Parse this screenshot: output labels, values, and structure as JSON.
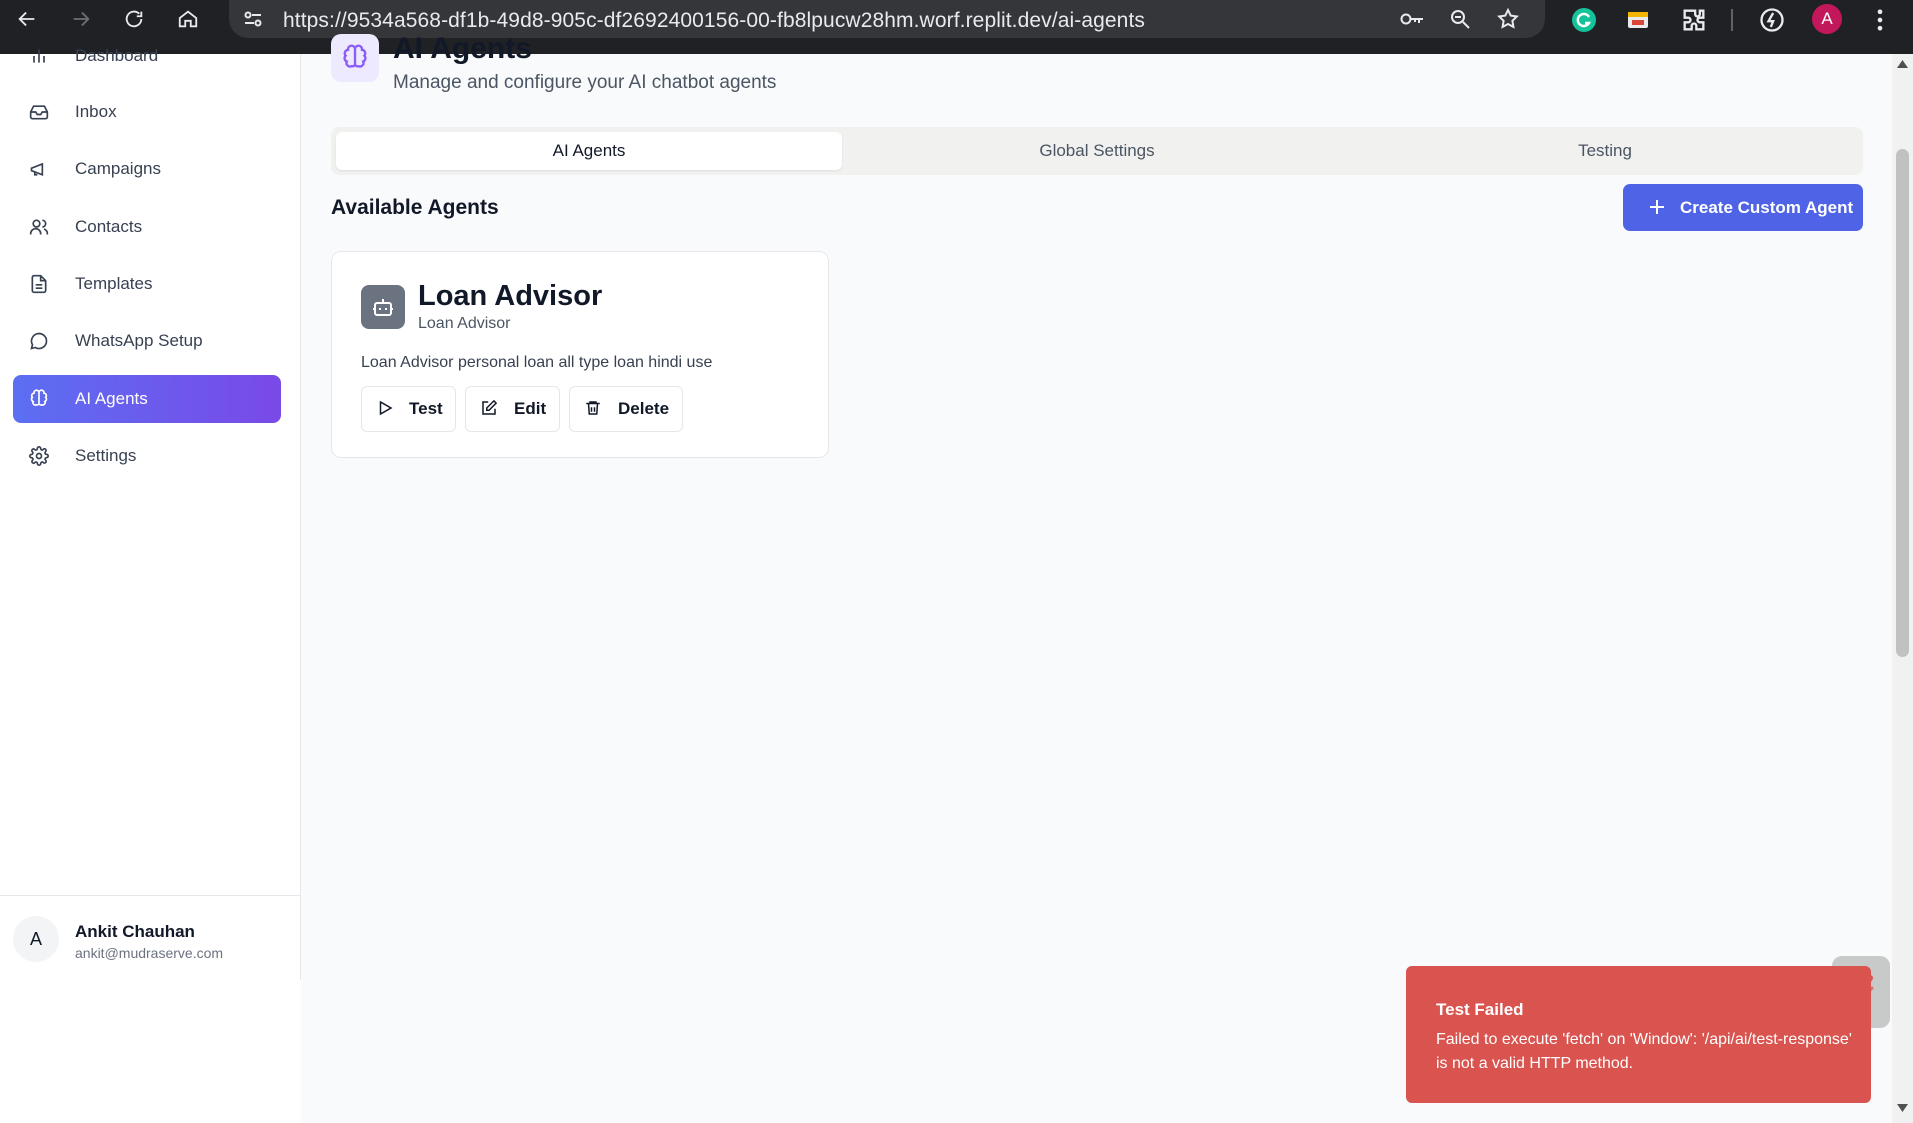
{
  "browser": {
    "url": "https://9534a568-df1b-49d8-905c-df2692400156-00-fb8lpucw28hm.worf.replit.dev/ai-agents",
    "profile_initial": "A",
    "icons": [
      "back-icon",
      "forward-icon",
      "reload-icon",
      "home-icon",
      "site-settings-icon",
      "password-key-icon",
      "zoom-icon",
      "bookmark-star-icon",
      "grammarly-icon",
      "extension-icon",
      "puzzle-extensions-icon",
      "speed-icon",
      "menu-kebab-icon"
    ]
  },
  "sidebar": {
    "items": [
      {
        "label": "Dashboard",
        "icon": "bar-chart-icon"
      },
      {
        "label": "Inbox",
        "icon": "inbox-icon"
      },
      {
        "label": "Campaigns",
        "icon": "megaphone-icon"
      },
      {
        "label": "Contacts",
        "icon": "users-icon"
      },
      {
        "label": "Templates",
        "icon": "file-text-icon"
      },
      {
        "label": "WhatsApp Setup",
        "icon": "message-circle-icon"
      },
      {
        "label": "AI Agents",
        "icon": "brain-icon",
        "active": true
      },
      {
        "label": "Settings",
        "icon": "gear-icon"
      }
    ],
    "user": {
      "initial": "A",
      "name": "Ankit Chauhan",
      "email": "ankit@mudraserve.com"
    }
  },
  "header": {
    "title": "AI Agents",
    "subtitle": "Manage and configure your AI chatbot agents"
  },
  "tabs": [
    {
      "label": "AI Agents",
      "active": true
    },
    {
      "label": "Global Settings"
    },
    {
      "label": "Testing"
    }
  ],
  "section": {
    "title": "Available Agents",
    "create_label": "Create Custom Agent"
  },
  "agents": [
    {
      "name": "Loan Advisor",
      "role": "Loan Advisor",
      "description": "Loan Advisor personal loan all type loan hindi use",
      "actions": {
        "test": "Test",
        "edit": "Edit",
        "delete": "Delete"
      }
    }
  ],
  "toast": {
    "title": "Test Failed",
    "message": "Failed to execute 'fetch' on 'Window': '/api/ai/test-response' is not a valid HTTP method."
  },
  "colors": {
    "accent_start": "#5b6ff2",
    "accent_end": "#7a49e8",
    "primary_button": "#4f63e6",
    "toast_error": "#d9534f"
  }
}
